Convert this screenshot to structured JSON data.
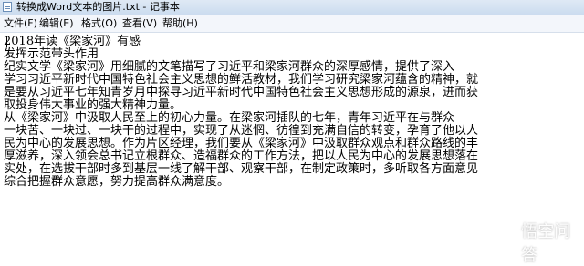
{
  "window": {
    "title": "转换成Word文本的图片.txt - 记事本"
  },
  "menubar": {
    "items": [
      {
        "label": "文件(F)"
      },
      {
        "label": "编辑(E)"
      },
      {
        "label": "格式(O)"
      },
      {
        "label": "查看(V)"
      },
      {
        "label": "帮助(H)"
      }
    ]
  },
  "document": {
    "lines": [
      "2018年读《梁家河》有感",
      "发挥示范带头作用",
      "纪实文学《梁家河》用细腻的文笔描写了习近平和梁家河群众的深厚感情，提供了深入",
      "学习习近平新时代中国特色社会主义思想的鲜活教材，我们学习研究梁家河蕴含的精神，就",
      "是要从习近平七年知青岁月中探寻习近平新时代中国特色社会主义思想形成的源泉，进而获",
      "取投身伟大事业的强大精神力量。",
      "从《梁家河》中汲取人民至上的初心力量。在梁家河插队的七年，青年习近平在与群众",
      "一块苦、一块过、一块干的过程中，实现了从迷惘、彷徨到充满自信的转变，孕育了他以人",
      "民为中心的发展思想。作为片区经理，我们要从《梁家河》中汲取群众观点和群众路线的丰",
      "厚滋养，深入领会总书记立根群众、造福群众的工作方法，把以人民为中心的发展思想落在",
      "实处，在选拔干部时多到基层一线了解干部、观察干部，在制定政策时，多听取各方面意见",
      "综合把握群众意愿，努力提高群众满意度。"
    ]
  },
  "watermark": {
    "text": "悟空问答"
  }
}
